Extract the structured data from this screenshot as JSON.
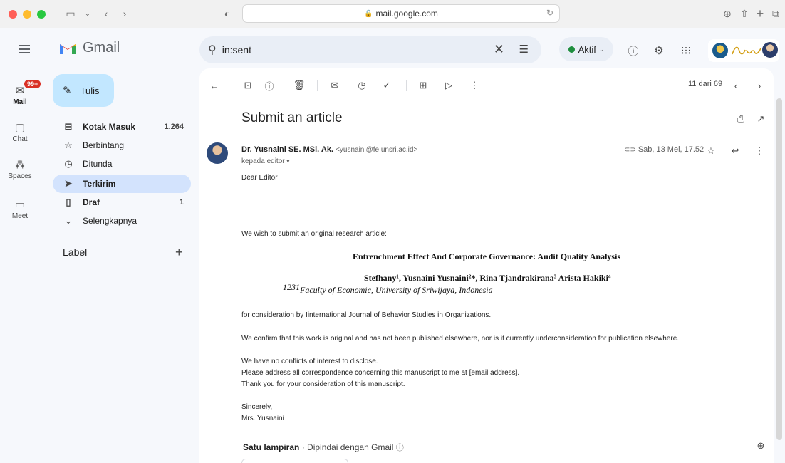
{
  "browser": {
    "url": "mail.google.com"
  },
  "app": {
    "name": "Gmail"
  },
  "search": {
    "query": "in:sent"
  },
  "status": {
    "label": "Aktif"
  },
  "rail": {
    "mail": "Mail",
    "mail_badge": "99+",
    "chat": "Chat",
    "spaces": "Spaces",
    "meet": "Meet"
  },
  "nav": {
    "compose": "Tulis",
    "items": [
      {
        "label": "Kotak Masuk",
        "count": "1.264",
        "icon": "inbox-icon"
      },
      {
        "label": "Berbintang",
        "count": "",
        "icon": "star-icon"
      },
      {
        "label": "Ditunda",
        "count": "",
        "icon": "clock-icon"
      },
      {
        "label": "Terkirim",
        "count": "",
        "icon": "send-icon"
      },
      {
        "label": "Draf",
        "count": "1",
        "icon": "draft-icon"
      },
      {
        "label": "Selengkapnya",
        "count": "",
        "icon": "chevron-down-icon"
      }
    ],
    "label_header": "Label"
  },
  "toolbar": {
    "pager": "11 dari 69"
  },
  "email": {
    "subject": "Submit an article",
    "sender_name": "Dr. Yusnaini SE. MSi. Ak.",
    "sender_email": "<yusnaini@fe.unsri.ac.id>",
    "to": "kepada editor",
    "date": "Sab, 13 Mei, 17.52",
    "greeting": "Dear Editor",
    "intro": "We wish to submit an original research article:",
    "paper_title": "Entrenchment Effect And Corporate Governance:  Audit Quality Analysis",
    "authors": "Stefhany¹, Yusnaini Yusnaini²*, Rina Tjandrakirana³ Arista Hakiki⁴",
    "affiliation_num": "1231",
    "affiliation": "Faculty of Economic, University of Sriwijaya, Indonesia",
    "consideration": "for consideration by Iinternational Journal of Behavior Studies in Organizations.",
    "confirm": "We confirm that this work is original and has not been published elsewhere, nor is it currently underconsideration for publication elsewhere.",
    "conflicts": "We have no conflicts of interest to disclose.",
    "address": "Please address all correspondence concerning this manuscript to me at [email address].",
    "thanks": "Thank you for your consideration of this manuscript.",
    "closing": "Sincerely,",
    "signature": "Mrs. Yusnaini"
  },
  "attachment": {
    "label": "Satu lampiran",
    "scan": "Dipindai dengan Gmail"
  }
}
